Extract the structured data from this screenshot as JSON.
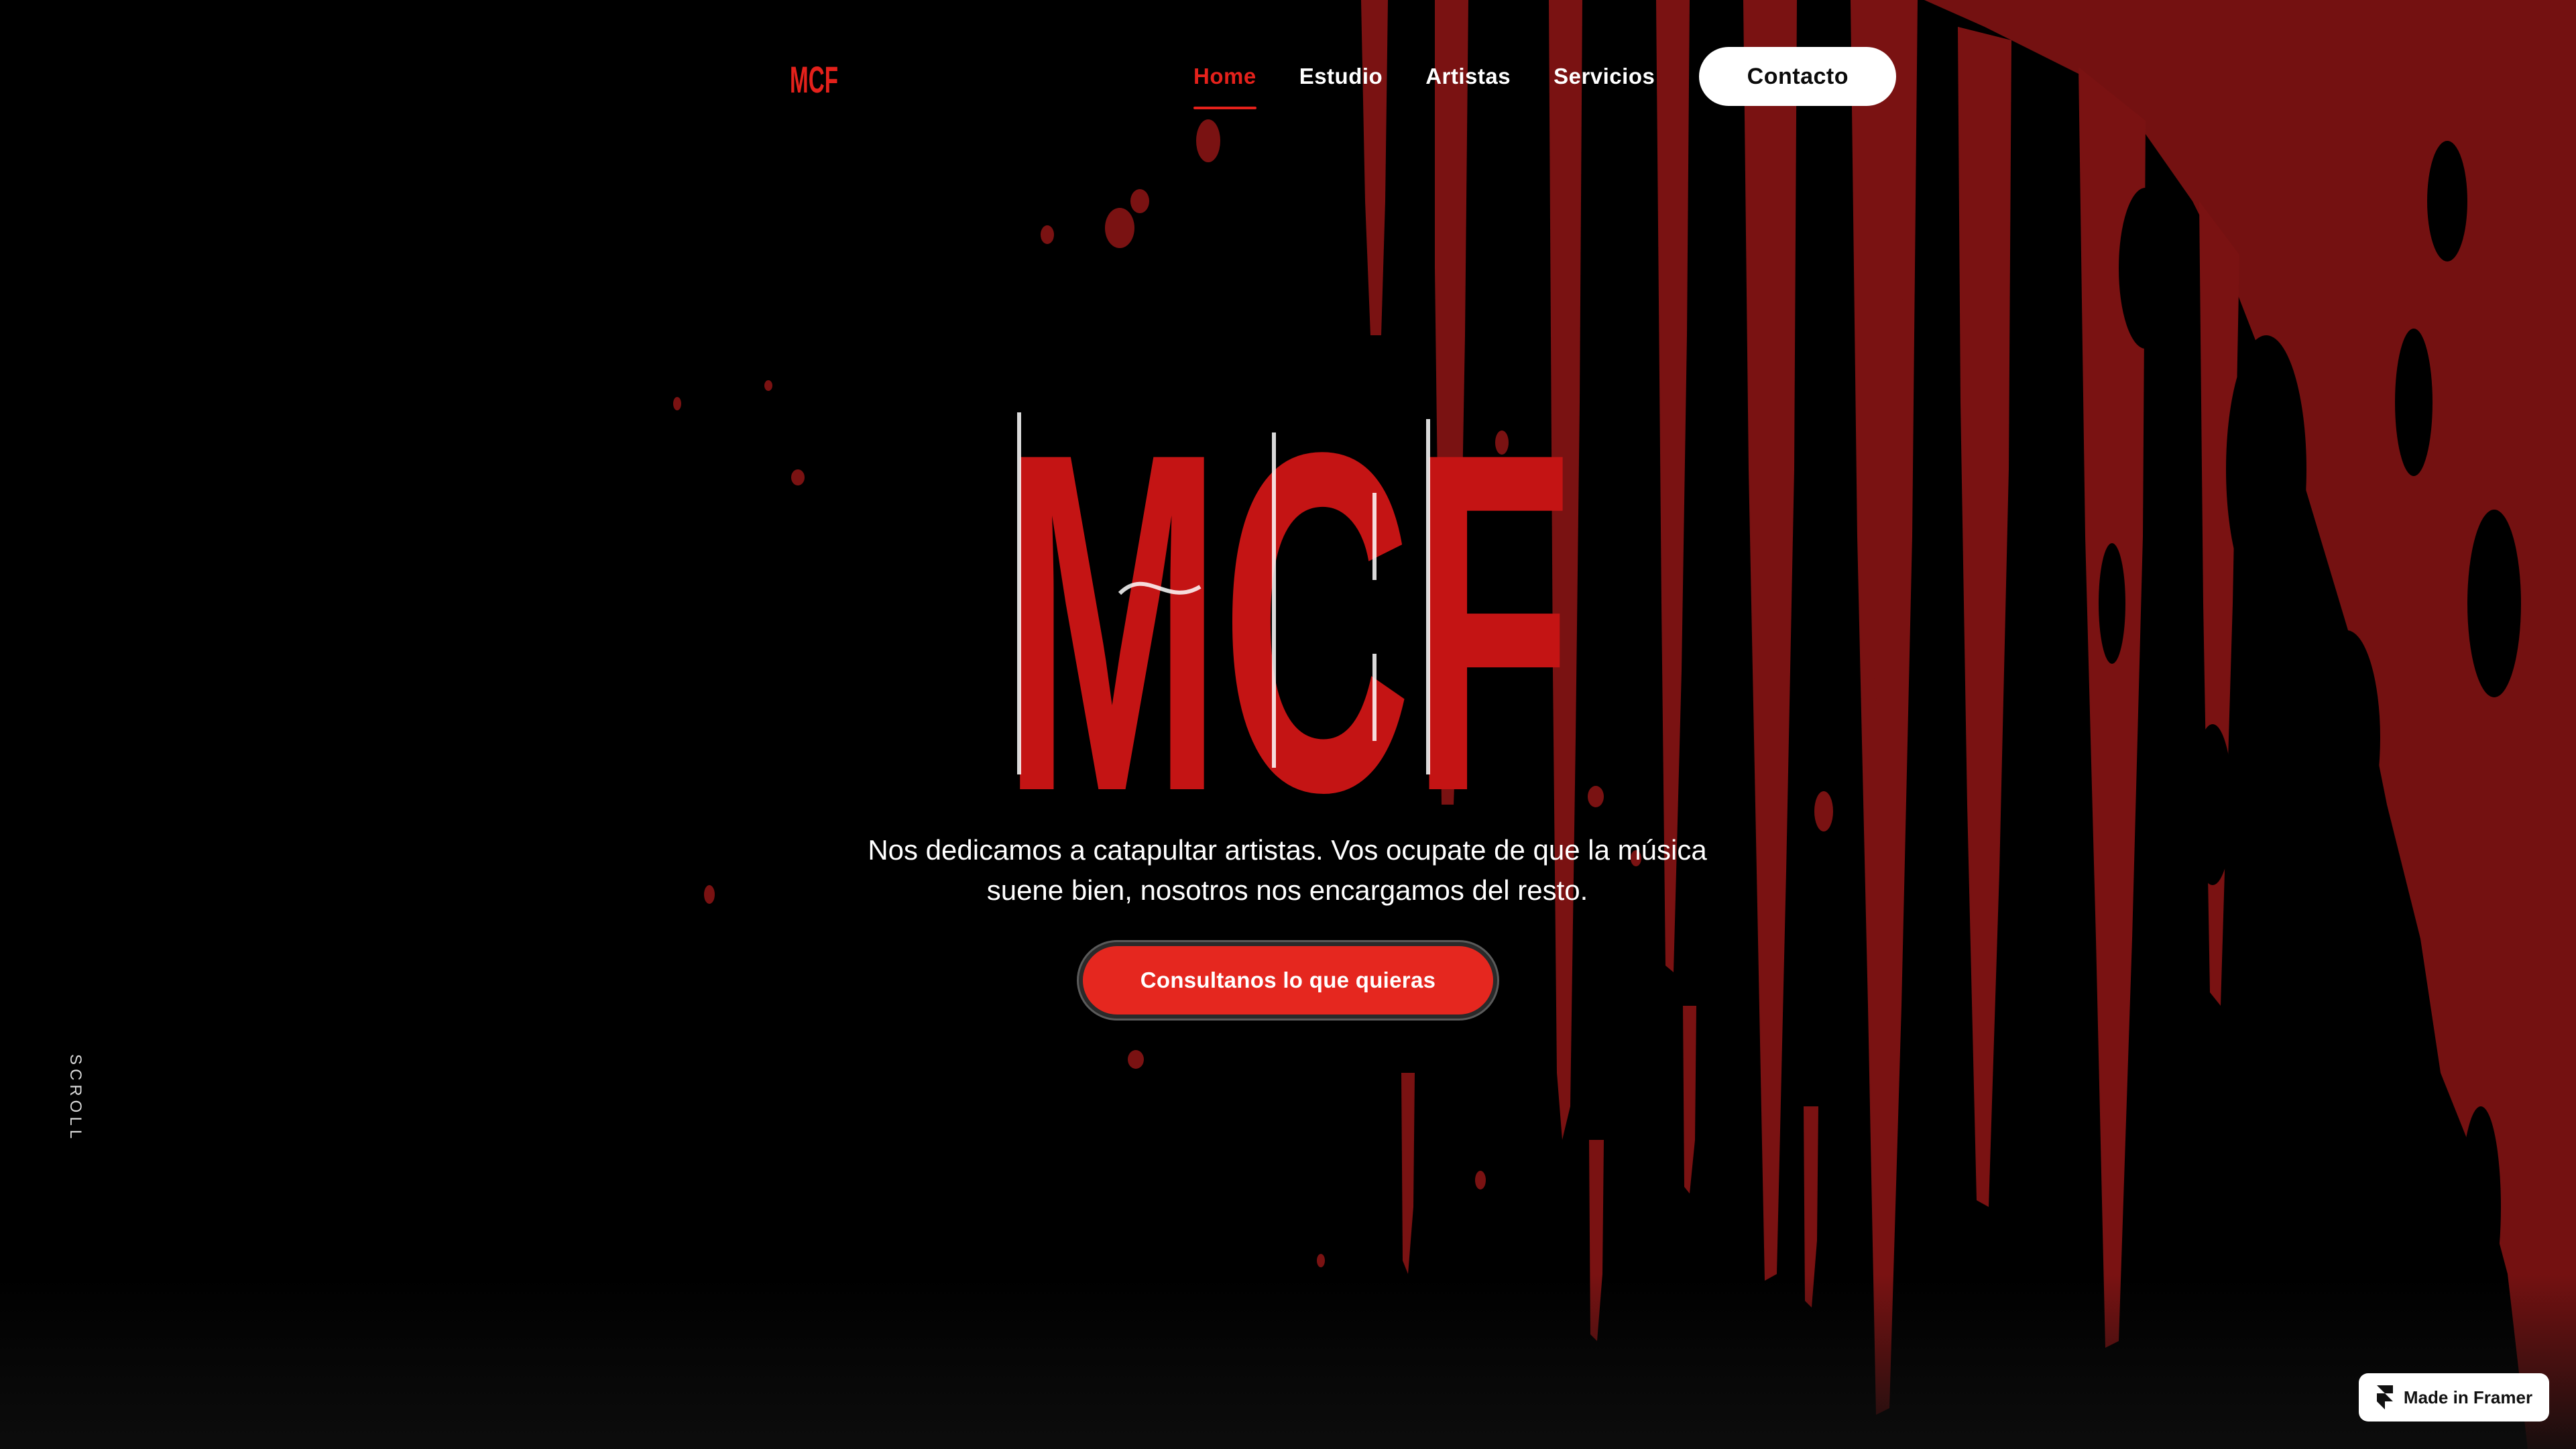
{
  "brand": {
    "logo_text": "MCF",
    "accent_color": "#e4211b",
    "blood_color": "#7a1212"
  },
  "nav": {
    "items": [
      {
        "label": "Home",
        "active": true
      },
      {
        "label": "Estudio",
        "active": false
      },
      {
        "label": "Artistas",
        "active": false
      },
      {
        "label": "Servicios",
        "active": false
      }
    ],
    "contact_label": "Contacto"
  },
  "hero": {
    "title": "MCF",
    "tagline_line1": "Nos dedicamos a catapultar artistas. Vos ocupate de que la música",
    "tagline_line2": "suene bien, nosotros nos encargamos del resto.",
    "cta_label": "Consultanos lo que quieras"
  },
  "side": {
    "scroll_label": "SCROLL"
  },
  "badge": {
    "label": "Made in Framer",
    "icon": "framer-icon"
  }
}
